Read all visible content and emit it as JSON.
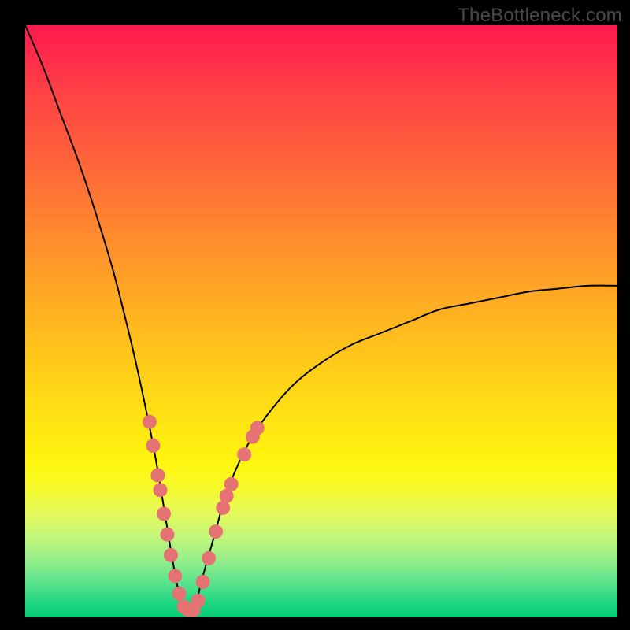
{
  "watermark": "TheBottleneck.com",
  "colors": {
    "frame": "#000000",
    "curve": "#000000",
    "marker_fill": "#e57373",
    "marker_stroke": "#d15a5a"
  },
  "chart_data": {
    "type": "line",
    "title": "",
    "xlabel": "",
    "ylabel": "",
    "xlim": [
      0,
      100
    ],
    "ylim": [
      0,
      100
    ],
    "grid": false,
    "legend": false,
    "note": "V-shaped bottleneck curve; minimum ≈ 0% near x≈27; rises to ~100% at x=0 and ~56% at x=100. Axis values are not labeled in the source image and are estimated from geometry.",
    "series": [
      {
        "name": "bottleneck-curve",
        "x": [
          0,
          3,
          6,
          9,
          12,
          15,
          18,
          20,
          22,
          24,
          25,
          26,
          27,
          28,
          29,
          30,
          32,
          34,
          37,
          40,
          45,
          50,
          55,
          60,
          65,
          70,
          75,
          80,
          85,
          90,
          95,
          100
        ],
        "y": [
          100,
          93,
          85,
          77,
          68,
          58,
          46,
          37,
          27,
          15,
          9,
          4,
          1,
          1,
          3,
          7,
          14,
          21,
          28,
          33,
          39,
          43,
          46,
          48,
          50,
          52,
          53,
          54,
          55,
          55.5,
          56,
          56
        ]
      }
    ],
    "markers": [
      {
        "x": 21.0,
        "y": 33.0
      },
      {
        "x": 21.6,
        "y": 29.0
      },
      {
        "x": 22.4,
        "y": 24.0
      },
      {
        "x": 22.8,
        "y": 21.5
      },
      {
        "x": 23.4,
        "y": 17.5
      },
      {
        "x": 24.0,
        "y": 14.0
      },
      {
        "x": 24.6,
        "y": 10.5
      },
      {
        "x": 25.3,
        "y": 7.0
      },
      {
        "x": 26.0,
        "y": 4.0
      },
      {
        "x": 26.8,
        "y": 1.8
      },
      {
        "x": 27.6,
        "y": 1.2
      },
      {
        "x": 28.4,
        "y": 1.2
      },
      {
        "x": 29.2,
        "y": 2.8
      },
      {
        "x": 30.0,
        "y": 6.0
      },
      {
        "x": 31.0,
        "y": 10.0
      },
      {
        "x": 32.2,
        "y": 14.5
      },
      {
        "x": 33.4,
        "y": 18.5
      },
      {
        "x": 34.0,
        "y": 20.5
      },
      {
        "x": 34.8,
        "y": 22.5
      },
      {
        "x": 37.0,
        "y": 27.5
      },
      {
        "x": 38.4,
        "y": 30.5
      },
      {
        "x": 39.2,
        "y": 32.0
      }
    ]
  }
}
